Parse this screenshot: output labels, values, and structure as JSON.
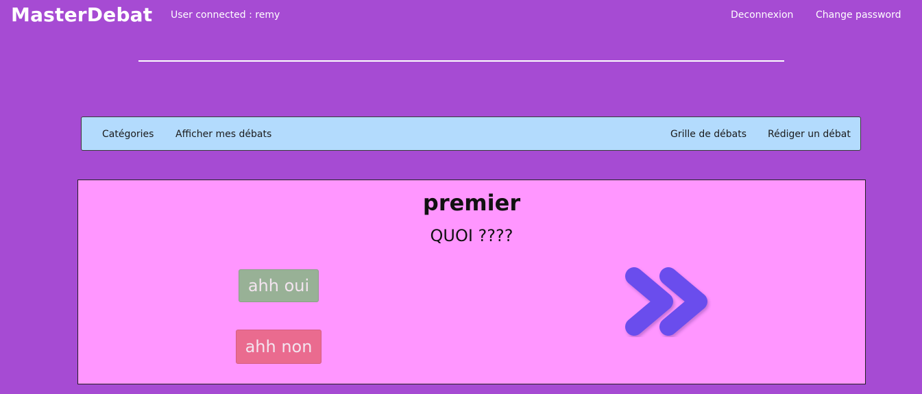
{
  "header": {
    "brand": "MasterDebat",
    "user_connected": "User connected : remy",
    "links": {
      "deconnexion": "Deconnexion",
      "change_password": "Change password"
    }
  },
  "navbar": {
    "left": [
      "Catégories",
      "Afficher mes débats"
    ],
    "right": [
      "Grille de débats",
      "Rédiger un débat"
    ]
  },
  "debate": {
    "title": "premier",
    "question": "QUOI ????",
    "yes_label": "ahh oui",
    "no_label": "ahh non",
    "next_icon": "double-chevron-right-icon"
  },
  "colors": {
    "background": "#a64bd3",
    "navbar": "#b3dbfd",
    "card": "#ff96ff",
    "yes_button": "#98b196",
    "no_button": "#ea6b8f",
    "arrow": "#6a4ded"
  }
}
